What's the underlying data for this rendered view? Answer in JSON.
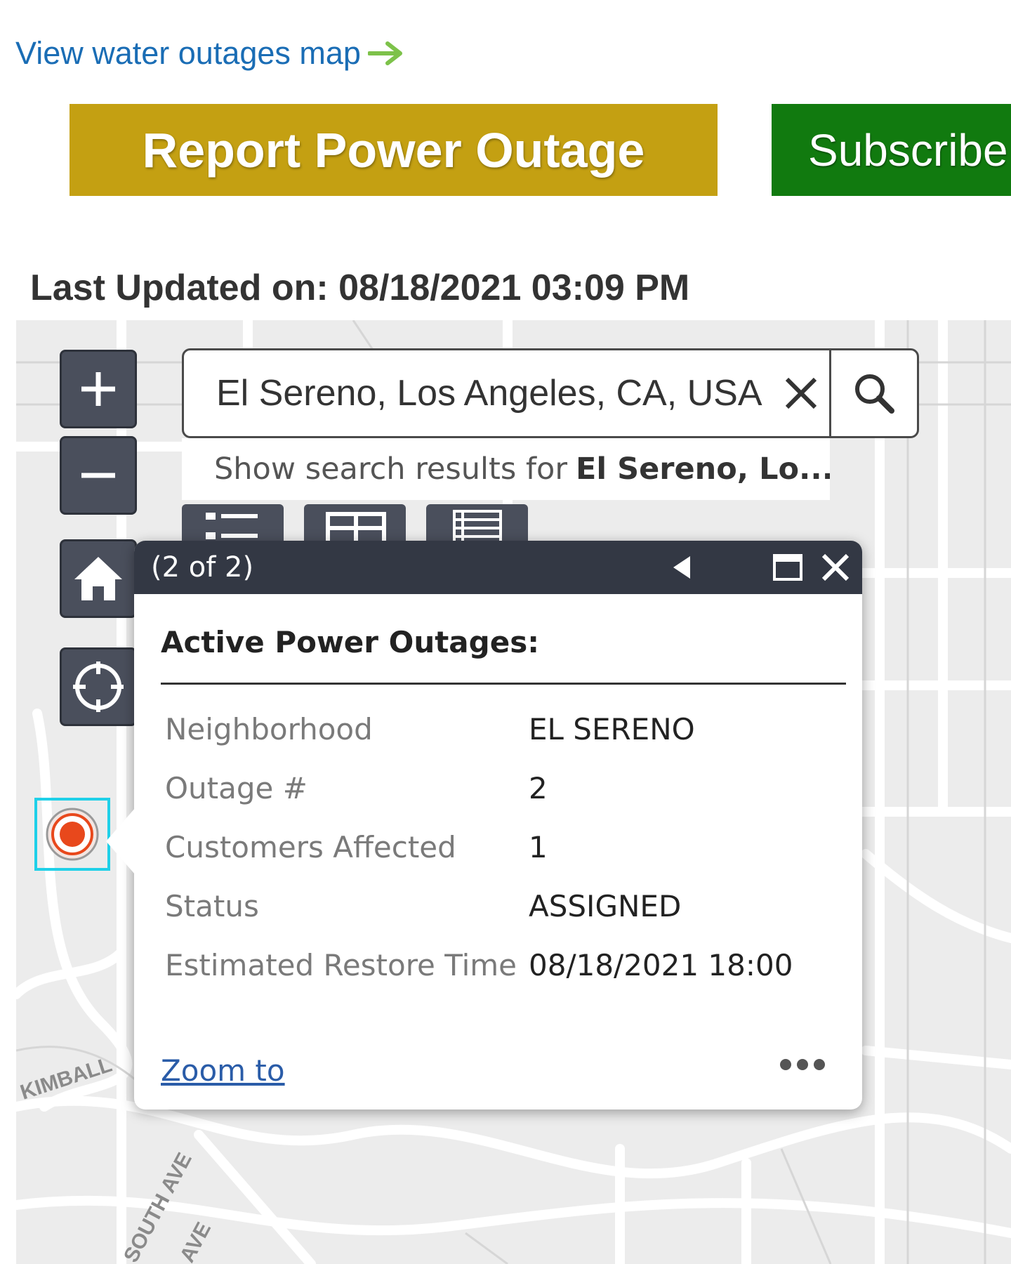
{
  "links": {
    "water_outages": "View water outages map"
  },
  "buttons": {
    "report_power_outage": "Report Power Outage",
    "subscribe": "Subscribe"
  },
  "status": {
    "last_updated": "Last Updated on: 08/18/2021 03:09 PM"
  },
  "map": {
    "search": {
      "value": "El Sereno, Los Angeles, CA, USA",
      "suggestion_prefix": "Show search results for",
      "suggestion_bold": "El Sereno, Lo..."
    },
    "controls": {
      "zoom_in_icon": "plus-icon",
      "zoom_out_icon": "minus-icon",
      "home_icon": "home-icon",
      "locate_icon": "crosshair-icon"
    },
    "street_labels": [
      "KIMBALL",
      "SOUTH AVE",
      "AVE"
    ],
    "popup": {
      "counter": "(2 of 2)",
      "title": "Active Power Outages:",
      "fields": [
        {
          "name": "Neighborhood",
          "value": "EL SERENO"
        },
        {
          "name": "Outage #",
          "value": "2"
        },
        {
          "name": "Customers Affected",
          "value": "1"
        },
        {
          "name": "Status",
          "value": "ASSIGNED"
        },
        {
          "name": "Estimated Restore Time",
          "value": "08/18/2021 18:00"
        }
      ],
      "zoom_to": "Zoom to"
    },
    "colors": {
      "marker": "#e8481c",
      "selection": "#1fd0e8",
      "popup_header": "#333844"
    }
  }
}
